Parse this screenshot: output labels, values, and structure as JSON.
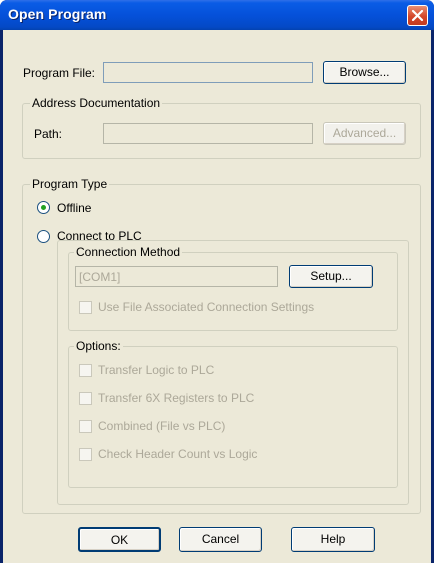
{
  "window": {
    "title": "Open Program"
  },
  "program_file": {
    "label": "Program File:",
    "value": "",
    "browse_label": "Browse..."
  },
  "address_doc": {
    "legend": "Address Documentation",
    "path_label": "Path:",
    "path_value": "",
    "advanced_label": "Advanced..."
  },
  "program_type": {
    "legend": "Program Type",
    "offline_label": "Offline",
    "connect_label": "Connect to PLC",
    "selected": "Offline"
  },
  "connection_method": {
    "legend": "Connection Method",
    "port_value": "[COM1]",
    "setup_label": "Setup...",
    "use_file_label": "Use File Associated Connection Settings"
  },
  "options": {
    "legend": "Options:",
    "items": [
      {
        "label": "Transfer Logic to PLC",
        "checked": false
      },
      {
        "label": "Transfer 6X Registers to PLC",
        "checked": false
      },
      {
        "label": "Combined (File vs PLC)",
        "checked": false
      },
      {
        "label": "Check Header Count vs Logic",
        "checked": false
      }
    ]
  },
  "footer": {
    "ok_label": "OK",
    "cancel_label": "Cancel",
    "help_label": "Help"
  },
  "colors": {
    "titlebar": "#0551DA",
    "dialog_bg": "#ECE9D8",
    "radio_dot": "#21A121",
    "close_button": "#D4462A"
  }
}
